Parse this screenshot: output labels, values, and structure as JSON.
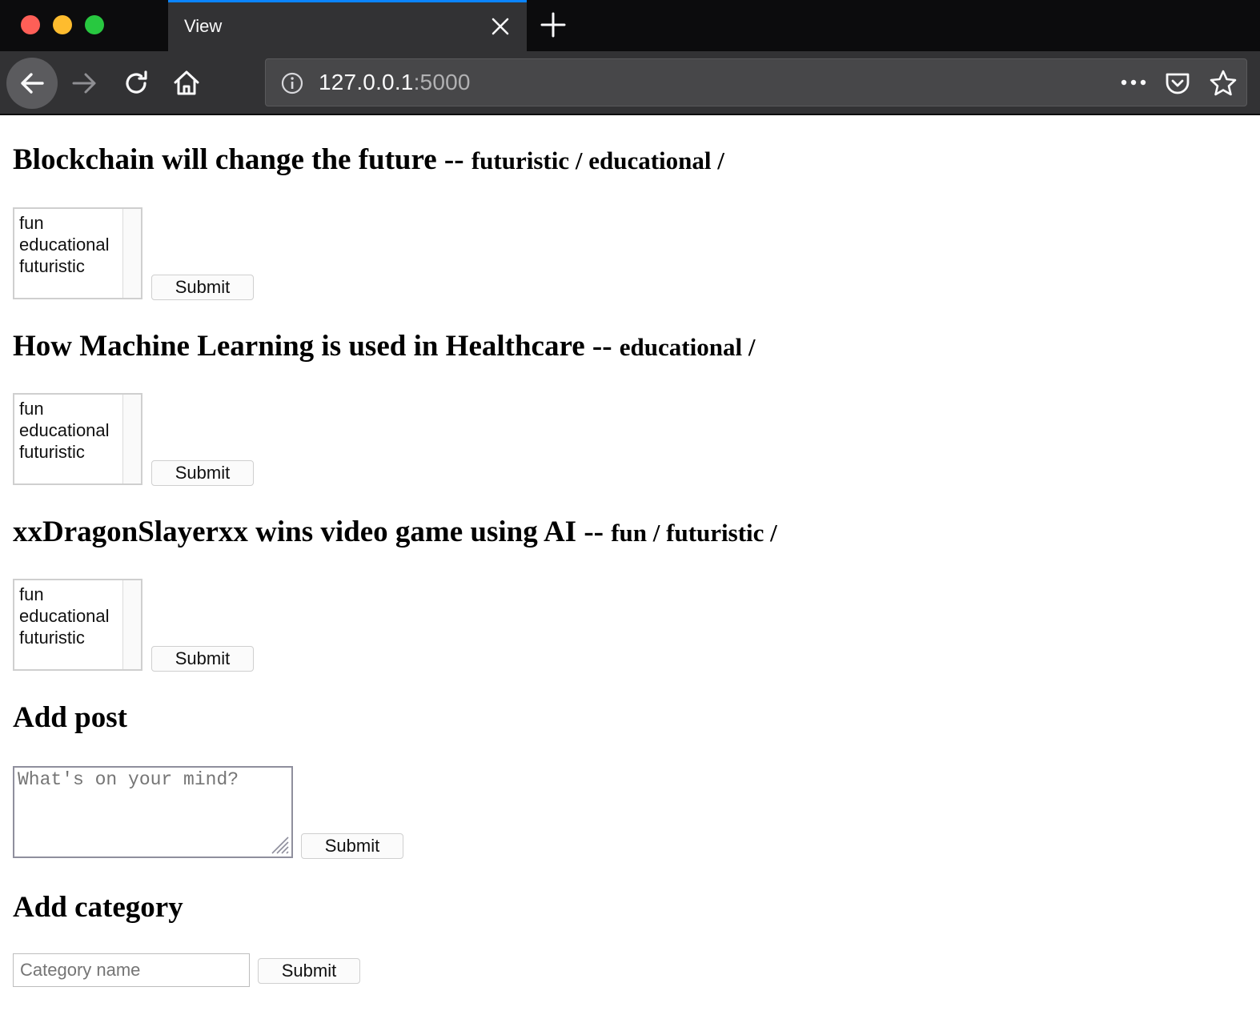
{
  "browser": {
    "tab_title": "View",
    "url_host": "127.0.0.1",
    "url_port": ":5000"
  },
  "category_options": [
    "fun",
    "educational",
    "futuristic"
  ],
  "posts": [
    {
      "title": "Blockchain will change the future -- ",
      "categories": "futuristic / educational /",
      "submit_label": "Submit"
    },
    {
      "title": "How Machine Learning is used in Healthcare -- ",
      "categories": "educational /",
      "submit_label": "Submit"
    },
    {
      "title": "xxDragonSlayerxx wins video game using AI -- ",
      "categories": "fun / futuristic /",
      "submit_label": "Submit"
    }
  ],
  "add_post": {
    "heading": "Add post",
    "placeholder": "What's on your mind?",
    "submit_label": "Submit"
  },
  "add_category": {
    "heading": "Add category",
    "placeholder": "Category name",
    "submit_label": "Submit"
  }
}
